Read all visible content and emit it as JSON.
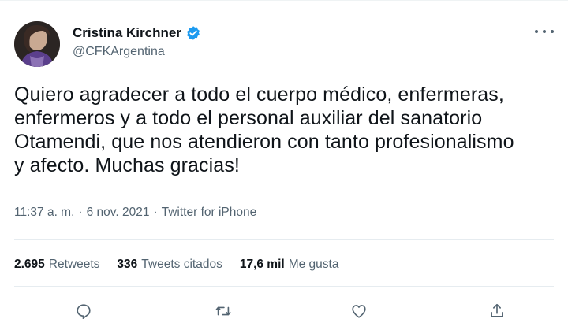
{
  "tweet": {
    "author": {
      "display_name": "Cristina Kirchner",
      "handle": "@CFKArgentina",
      "verified": true
    },
    "text": "Quiero agradecer a todo el cuerpo médico, enfermeras, enfermeros y a todo el personal auxiliar del sanatorio Otamendi, que nos atendieron con tanto profesionalismo y afecto. Muchas gracias!",
    "time": "11:37 a. m.",
    "separator": "·",
    "date": "6 nov. 2021",
    "client": "Twitter for iPhone",
    "stats": {
      "retweets_count": "2.695",
      "retweets_label": "Retweets",
      "quotes_count": "336",
      "quotes_label": "Tweets citados",
      "likes_count": "17,6 mil",
      "likes_label": "Me gusta"
    },
    "icons": {
      "verified": "verified-badge-icon",
      "more": "more-options-icon",
      "reply": "reply-icon",
      "retweet": "retweet-icon",
      "like": "like-icon",
      "share": "share-icon"
    },
    "colors": {
      "verified": "#1d9bf0",
      "text": "#0f1419",
      "secondary": "#536471"
    }
  }
}
